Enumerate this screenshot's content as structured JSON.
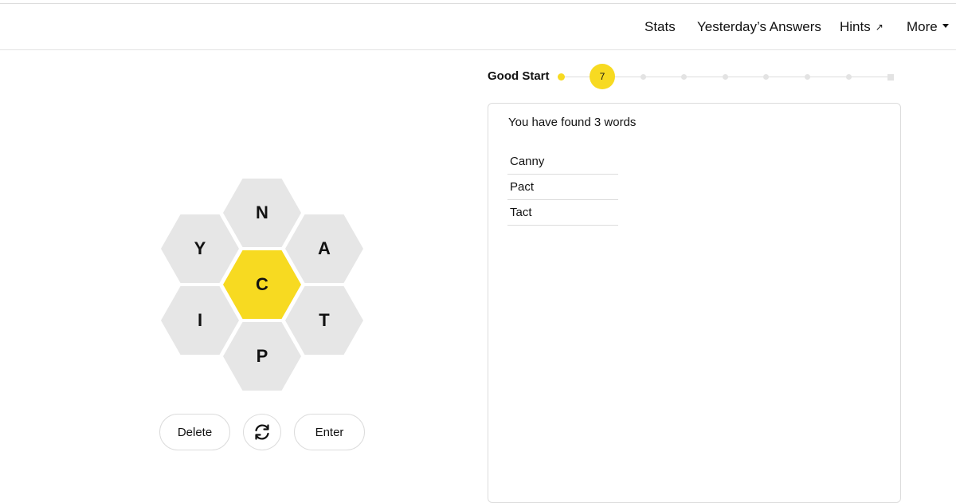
{
  "header": {
    "nav": {
      "stats": "Stats",
      "yesterday": "Yesterday’s Answers",
      "hints": "Hints",
      "more": "More"
    }
  },
  "progress": {
    "rank": "Good Start",
    "score": "7"
  },
  "word_panel": {
    "found_text": "You have found 3 words",
    "words": [
      "Canny",
      "Pact",
      "Tact"
    ]
  },
  "hive": {
    "center_letter": "C",
    "letters": {
      "top": "N",
      "upper_left": "Y",
      "upper_right": "A",
      "lower_left": "I",
      "lower_right": "T",
      "bottom": "P"
    }
  },
  "controls": {
    "delete": "Delete",
    "enter": "Enter"
  },
  "colors": {
    "accent": "#f7da21",
    "hex_gray": "#e6e6e6",
    "border": "#dcdcdc"
  },
  "icons": {
    "shuffle": "shuffle-icon",
    "hints_arrow": "external-arrow-icon",
    "more_caret": "caret-down-icon"
  }
}
